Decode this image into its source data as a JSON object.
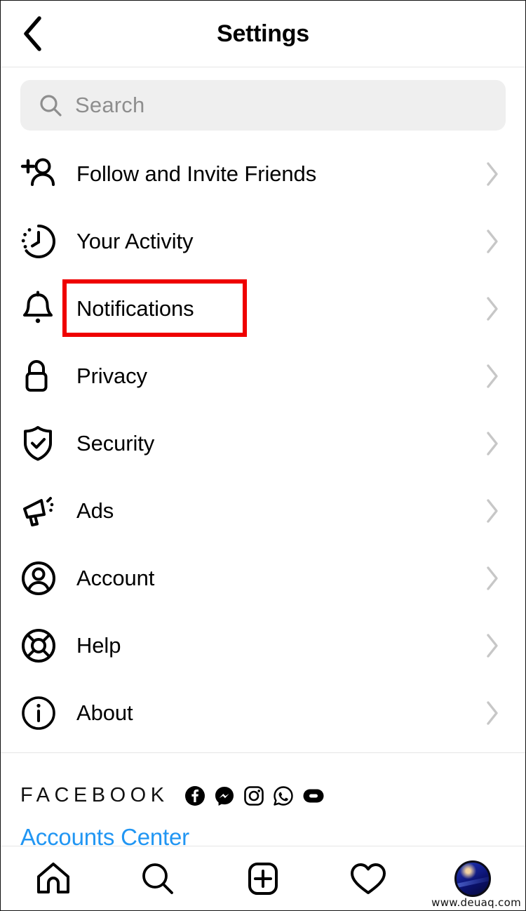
{
  "header": {
    "title": "Settings",
    "back_icon": "chevron-left-icon"
  },
  "search": {
    "placeholder": "Search",
    "value": "",
    "icon": "search-icon"
  },
  "menu": {
    "items": [
      {
        "label": "Follow and Invite Friends",
        "icon": "person-add-icon",
        "highlighted": false
      },
      {
        "label": "Your Activity",
        "icon": "activity-clock-icon",
        "highlighted": false
      },
      {
        "label": "Notifications",
        "icon": "bell-icon",
        "highlighted": true
      },
      {
        "label": "Privacy",
        "icon": "lock-icon",
        "highlighted": false
      },
      {
        "label": "Security",
        "icon": "shield-check-icon",
        "highlighted": false
      },
      {
        "label": "Ads",
        "icon": "megaphone-icon",
        "highlighted": false
      },
      {
        "label": "Account",
        "icon": "user-circle-icon",
        "highlighted": false
      },
      {
        "label": "Help",
        "icon": "lifebuoy-icon",
        "highlighted": false
      },
      {
        "label": "About",
        "icon": "info-circle-icon",
        "highlighted": false
      }
    ],
    "chevron_icon": "chevron-right-icon"
  },
  "footer": {
    "wordmark": "FACEBOOK",
    "app_icons": [
      "facebook-icon",
      "messenger-icon",
      "instagram-icon",
      "whatsapp-icon",
      "portal-icon"
    ],
    "accounts_center_label": "Accounts Center"
  },
  "bottom_nav": {
    "items": [
      {
        "icon": "home-icon"
      },
      {
        "icon": "search-icon"
      },
      {
        "icon": "add-post-icon"
      },
      {
        "icon": "heart-icon"
      },
      {
        "icon": "profile-avatar-icon"
      }
    ]
  },
  "watermark": "www.deuaq.com",
  "colors": {
    "link_blue": "#2196f3",
    "highlight_red": "#ef0000",
    "search_bg": "#efefef",
    "chevron_gray": "#c7c7c7"
  }
}
